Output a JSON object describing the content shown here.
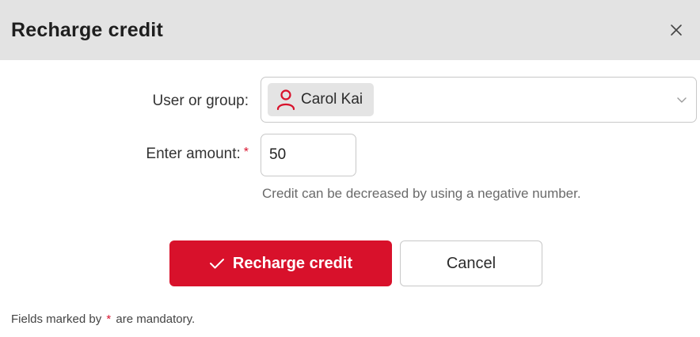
{
  "dialog": {
    "title": "Recharge credit",
    "close_icon": "close-icon"
  },
  "form": {
    "user_label": "User or group:",
    "user_chip": {
      "icon": "user-icon",
      "name": "Carol Kai",
      "icon_color": "#d8112b"
    },
    "amount_label": "Enter amount:",
    "required_marker": "*",
    "amount_value": "50",
    "amount_hint": "Credit can be decreased by using a negative number."
  },
  "actions": {
    "primary_icon": "checkmark-icon",
    "primary_label": "Recharge credit",
    "secondary_label": "Cancel"
  },
  "footer": {
    "prefix": "Fields marked by",
    "star": "*",
    "suffix": "are mandatory."
  },
  "colors": {
    "accent": "#d8112b",
    "titlebar_bg": "#e3e3e3"
  }
}
